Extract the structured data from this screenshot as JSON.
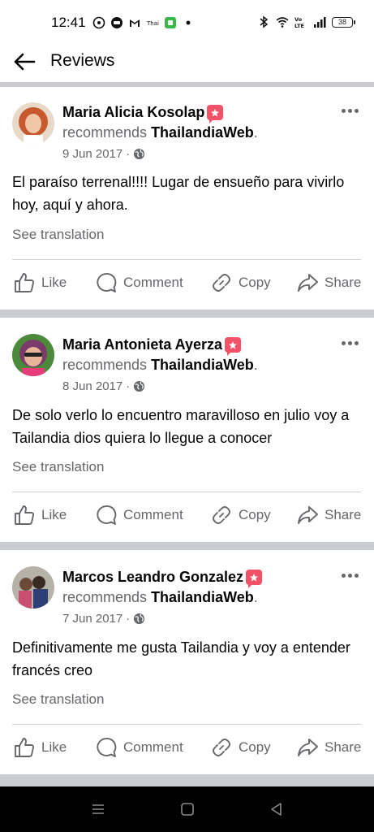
{
  "status_bar": {
    "time": "12:41",
    "battery": "38",
    "network_label": "Vo LTE"
  },
  "header": {
    "title": "Reviews"
  },
  "reviews": [
    {
      "name": "Maria Alicia Kosolap",
      "recommends_prefix": "recommends",
      "page_name": "ThailandiaWeb",
      "suffix": ".",
      "date": "9 Jun 2017",
      "separator": "·",
      "text": "El paraíso terrenal!!!! Lugar de ensueño para vivirlo hoy, aquí y ahora.",
      "translation_label": "See translation"
    },
    {
      "name": "Maria Antonieta Ayerza",
      "recommends_prefix": "recommends",
      "page_name": "ThailandiaWeb",
      "suffix": ".",
      "date": "8 Jun 2017",
      "separator": "·",
      "text": "De solo verlo lo encuentro maravilloso en julio voy a Tailandia dios quiera lo llegue a conocer",
      "translation_label": "See translation"
    },
    {
      "name": "Marcos Leandro Gonzalez",
      "recommends_prefix": "recommends",
      "page_name": "ThailandiaWeb",
      "suffix": ".",
      "date": "7 Jun 2017",
      "separator": "·",
      "text": "Definitivamente me gusta Tailandia y voy a entender francés creo",
      "translation_label": "See translation"
    }
  ],
  "actions": {
    "like": "Like",
    "comment": "Comment",
    "copy": "Copy",
    "share": "Share"
  },
  "colors": {
    "accent_badge": "#f25268",
    "secondary_text": "#65676b",
    "primary_text": "#050505",
    "divider": "#c9ccd1"
  },
  "icons": [
    "back-arrow-icon",
    "globe-icon",
    "more-options-icon",
    "like-icon",
    "comment-icon",
    "copy-link-icon",
    "share-icon",
    "recommend-badge-icon"
  ]
}
